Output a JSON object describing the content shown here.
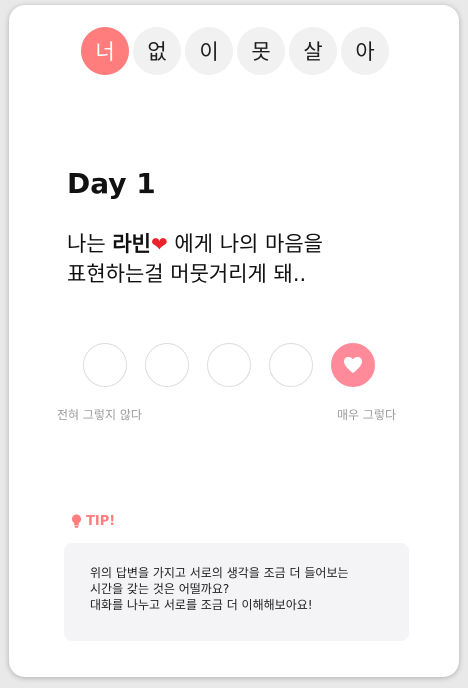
{
  "tabs": [
    {
      "label": "너",
      "active": true
    },
    {
      "label": "없",
      "active": false
    },
    {
      "label": "이",
      "active": false
    },
    {
      "label": "못",
      "active": false
    },
    {
      "label": "살",
      "active": false
    },
    {
      "label": "아",
      "active": false
    }
  ],
  "day_title": "Day 1",
  "question": {
    "prefix": "나는 ",
    "name": "라빈",
    "after_name": " 에게 나의 마음을",
    "line2": "표현하는걸 머뭇거리게 돼.."
  },
  "scale": {
    "options": 5,
    "selected_index": 4,
    "min_label": "전혀 그렇지 않다",
    "max_label": "매우 그렇다"
  },
  "tip": {
    "title": "TIP!",
    "lines": [
      "위의 답변을 가지고 서로의 생각을 조금 더 들어보는",
      "시간을 갖는 것은 어떨까요?",
      "대화를 나누고 서로를 조금 더 이해해보아요!"
    ]
  },
  "colors": {
    "accent": "#ff7d7d",
    "selected_option": "#ff8a9a",
    "tab_inactive": "#f1f1f1",
    "tip_background": "#f4f4f7"
  }
}
